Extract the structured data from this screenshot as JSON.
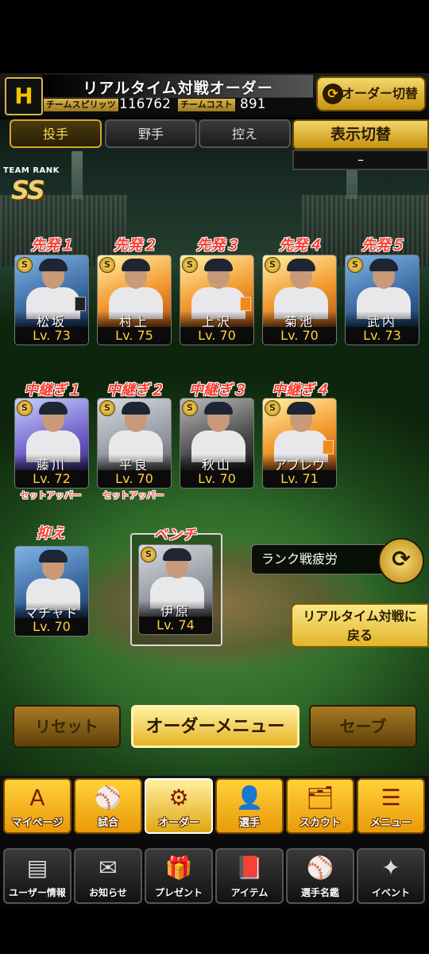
{
  "header": {
    "logo": "H",
    "title": "リアルタイム対戦オーダー",
    "team_spirits_label": "チームスピリッツ",
    "team_spirits_value": "116762",
    "team_cost_label": "チームコスト",
    "team_cost_value": "891",
    "order_switch_label": "オーダー切替"
  },
  "tabs": [
    {
      "label": "投手",
      "active": true
    },
    {
      "label": "野手",
      "active": false
    },
    {
      "label": "控え",
      "active": false
    }
  ],
  "display_switch": {
    "label": "表示切替",
    "value": "–"
  },
  "team_rank": {
    "label": "TEAM RANK",
    "value": "SS"
  },
  "starters": [
    {
      "position": "先発１",
      "name": "松坂",
      "level": "Lv. 73"
    },
    {
      "position": "先発２",
      "name": "村上",
      "level": "Lv. 75"
    },
    {
      "position": "先発３",
      "name": "上沢",
      "level": "Lv. 70"
    },
    {
      "position": "先発４",
      "name": "菊池",
      "level": "Lv. 70"
    },
    {
      "position": "先発５",
      "name": "武内",
      "level": "Lv. 73"
    }
  ],
  "relievers": [
    {
      "position": "中継ぎ１",
      "name": "藤川",
      "level": "Lv. 72",
      "note": "セットアッパー"
    },
    {
      "position": "中継ぎ２",
      "name": "平良",
      "level": "Lv. 70",
      "note": "セットアッパー"
    },
    {
      "position": "中継ぎ３",
      "name": "秋山",
      "level": "Lv. 70",
      "note": ""
    },
    {
      "position": "中継ぎ４",
      "name": "アブレウ",
      "level": "Lv. 71",
      "note": ""
    }
  ],
  "closer": {
    "position": "抑え",
    "name": "マチャド",
    "level": "Lv. 70"
  },
  "bench": {
    "position": "ベンチ",
    "name": "伊原",
    "level": "Lv. 74"
  },
  "rank_fatigue_label": "ランク戦疲労",
  "return_button": {
    "line1": "リアルタイム対戦に",
    "line2": "戻る"
  },
  "actions": {
    "reset": "リセット",
    "order_menu": "オーダーメニュー",
    "save": "セーブ"
  },
  "nav_primary": [
    {
      "label": "マイページ",
      "icon": "A"
    },
    {
      "label": "試合",
      "icon": "⚾"
    },
    {
      "label": "オーダー",
      "icon": "⚙"
    },
    {
      "label": "選手",
      "icon": "👤"
    },
    {
      "label": "スカウト",
      "icon": "🗂"
    },
    {
      "label": "メニュー",
      "icon": "☰"
    }
  ],
  "nav_secondary": [
    {
      "label": "ユーザー情報",
      "icon": "▤"
    },
    {
      "label": "お知らせ",
      "icon": "✉"
    },
    {
      "label": "プレゼント",
      "icon": "🎁"
    },
    {
      "label": "アイテム",
      "icon": "📕"
    },
    {
      "label": "選手名鑑",
      "icon": "⚾"
    },
    {
      "label": "イベント",
      "icon": "✦"
    }
  ]
}
